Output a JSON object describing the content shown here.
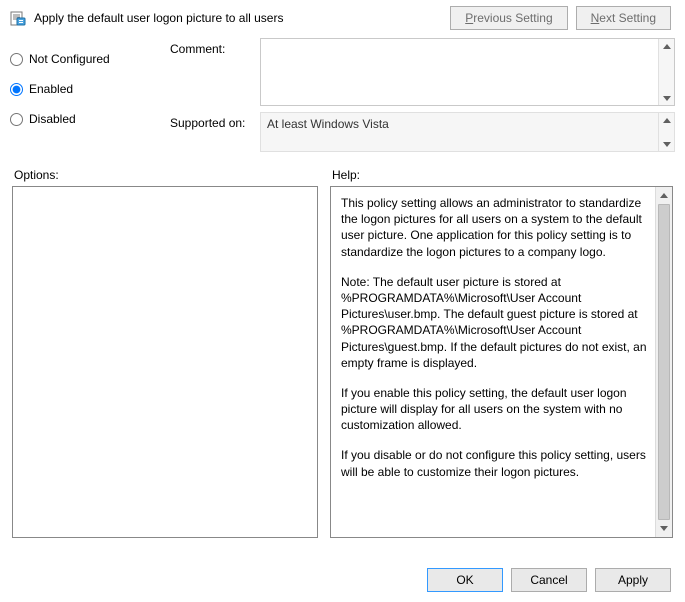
{
  "policy": {
    "title": "Apply the default user logon picture to all users"
  },
  "nav": {
    "previous": "Previous Setting",
    "next": "Next Setting"
  },
  "state": {
    "not_configured_label": "Not Configured",
    "enabled_label": "Enabled",
    "disabled_label": "Disabled",
    "selected": "enabled"
  },
  "fields": {
    "comment_label": "Comment:",
    "comment_value": "",
    "supported_label": "Supported on:",
    "supported_value": "At least Windows Vista"
  },
  "labels": {
    "options": "Options:",
    "help": "Help:"
  },
  "help": {
    "p1": "This policy setting allows an administrator to standardize the logon pictures for all users on a system to the default user picture. One application for this policy setting is to standardize the logon pictures to a company logo.",
    "p2": "Note: The default user picture is stored at %PROGRAMDATA%\\Microsoft\\User Account Pictures\\user.bmp. The default guest picture is stored at %PROGRAMDATA%\\Microsoft\\User Account Pictures\\guest.bmp. If the default pictures do not exist, an empty frame is displayed.",
    "p3": "If you enable this policy setting, the default user logon picture will display for all users on the system with no customization allowed.",
    "p4": "If you disable or do not configure this policy setting, users will be able to customize their logon pictures."
  },
  "buttons": {
    "ok": "OK",
    "cancel": "Cancel",
    "apply": "Apply"
  }
}
